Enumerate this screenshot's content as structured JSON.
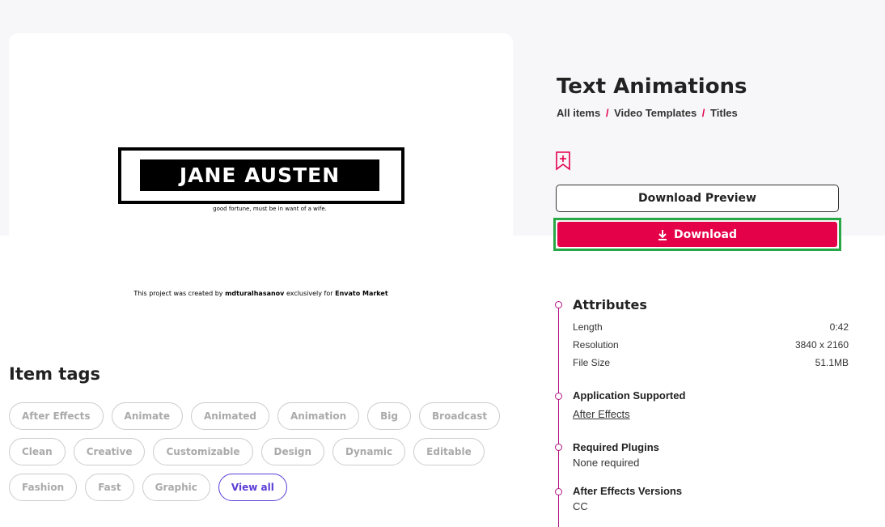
{
  "preview": {
    "heading": "JANE AUSTEN",
    "subtext": "good fortune, must be in want of a wife.",
    "credit_prefix": "This project was created by",
    "credit_author": "mdturalhasanov",
    "credit_middle": "exclusively for",
    "credit_market": "Envato Market"
  },
  "item": {
    "title": "Text Animations",
    "breadcrumb": [
      "All items",
      "Video Templates",
      "Titles"
    ],
    "breadcrumb_separator": "/",
    "bookmark_icon": "bookmark-plus-icon",
    "download_preview_label": "Download Preview",
    "download_label": "Download",
    "download_color": "#e5004a",
    "highlight_color": "#27a745"
  },
  "item_tags": {
    "title": "Item tags",
    "rows": [
      [
        "After Effects",
        "Animate",
        "Animated",
        "Animation",
        "Big",
        "Broadcast"
      ],
      [
        "Clean",
        "Creative",
        "Customizable",
        "Design",
        "Dynamic",
        "Editable"
      ],
      [
        "Fashion",
        "Fast",
        "Graphic"
      ]
    ],
    "view_all": "View all"
  },
  "attributes": {
    "title": "Attributes",
    "rows": [
      {
        "label": "Length",
        "value": "0:42"
      },
      {
        "label": "Resolution",
        "value": "3840 x 2160"
      },
      {
        "label": "File Size",
        "value": "51.1MB"
      }
    ]
  },
  "application_supported": {
    "title": "Application Supported",
    "value": "After Effects"
  },
  "required_plugins": {
    "title": "Required Plugins",
    "value": "None required"
  },
  "ae_versions": {
    "title": "After Effects Versions",
    "value": "CC"
  },
  "timeline_color": "#b0127f"
}
